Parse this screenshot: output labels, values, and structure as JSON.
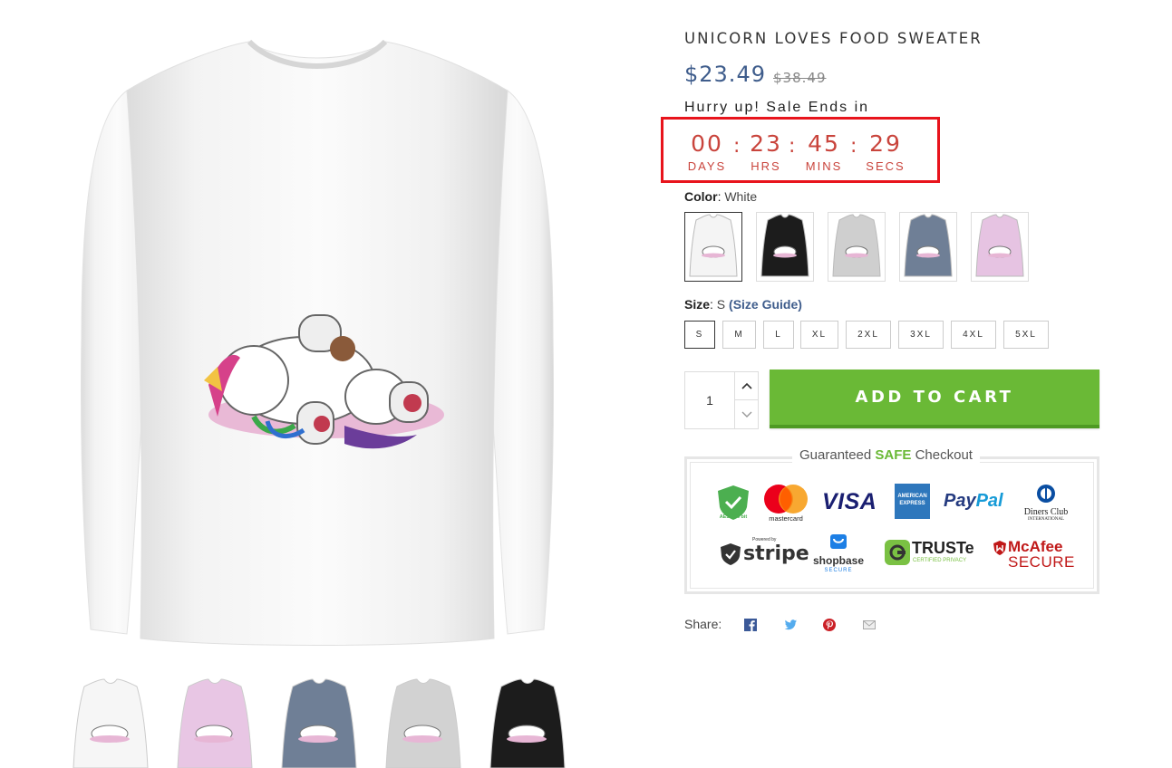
{
  "product": {
    "title": "UNICORN LOVES FOOD SWEATER",
    "price": "$23.49",
    "compare_price": "$38.49"
  },
  "countdown": {
    "heading": "Hurry up! Sale Ends in",
    "units": [
      {
        "value": "00",
        "label": "DAYS"
      },
      {
        "value": "23",
        "label": "HRS"
      },
      {
        "value": "45",
        "label": "MINS"
      },
      {
        "value": "29",
        "label": "SECS"
      }
    ],
    "separator": ":"
  },
  "color": {
    "label": "Color",
    "selected": "White",
    "swatches": [
      {
        "name": "White",
        "hex": "#f4f4f4"
      },
      {
        "name": "Black",
        "hex": "#1c1c1c"
      },
      {
        "name": "Grey",
        "hex": "#cfcfcf"
      },
      {
        "name": "Slate",
        "hex": "#6f7f96"
      },
      {
        "name": "Pink",
        "hex": "#e6c3e2"
      }
    ]
  },
  "size": {
    "label": "Size",
    "selected": "S",
    "guide": "(Size Guide)",
    "options": [
      "S",
      "M",
      "L",
      "XL",
      "2XL",
      "3XL",
      "4XL",
      "5XL"
    ]
  },
  "quantity": "1",
  "add_to_cart": "ADD TO CART",
  "checkout": {
    "title_pre": "Guaranteed",
    "title_safe": "SAFE",
    "title_post": "Checkout",
    "badges": {
      "aes": "AES-256 bit",
      "mastercard": "mastercard",
      "visa": "VISA",
      "amex_1": "AMERICAN",
      "amex_2": "EXPRESS",
      "paypal_a": "Pay",
      "paypal_b": "Pal",
      "diners_1": "Diners Club",
      "diners_2": "INTERNATIONAL",
      "stripe_top": "Powered by",
      "stripe": "stripe",
      "shopbase": "shopbase",
      "shopbase_sub": "SECURE",
      "truste": "TRUSTe",
      "truste_sub": "CERTIFIED PRIVACY",
      "mcafee": "McAfee",
      "mcafee_sub": "SECURE"
    }
  },
  "share": {
    "label": "Share:"
  },
  "thumbnails": [
    {
      "color": "#f6f6f6"
    },
    {
      "color": "#e8c6e4"
    },
    {
      "color": "#6f7f96"
    },
    {
      "color": "#d2d2d2"
    },
    {
      "color": "#1c1c1c"
    }
  ],
  "colors": {
    "accent_blue": "#3f5d8c",
    "countdown_red": "#c9443c",
    "highlight_red": "#e8141c",
    "cart_green": "#6ab936"
  }
}
